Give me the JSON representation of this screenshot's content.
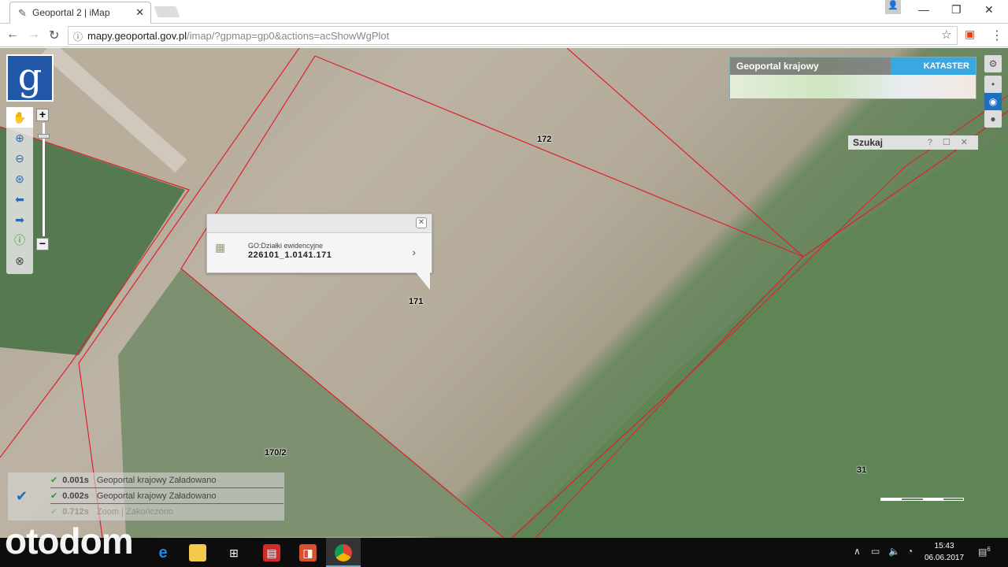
{
  "browser": {
    "tab_title": "Geoportal 2 | iMap",
    "url_host": "mapy.geoportal.gov.pl",
    "url_path": "/imap/?gpmap=gp0&actions=acShowWgPlot"
  },
  "map": {
    "logo": "g",
    "popup": {
      "layer": "GO:Działki ewidencyjne",
      "parcel_id": "226101_1.0141.171"
    },
    "parcel_labels": [
      "172",
      "171",
      "170/2",
      "31"
    ],
    "basemap": {
      "title": "Geoportal krajowy",
      "badge": "KATASTER"
    },
    "search_panel": {
      "title": "Szukaj",
      "controls": "? ☐ ✕"
    },
    "status": [
      {
        "time": "0.001s",
        "source": "Geoportal krajowy",
        "state": "Załadowano"
      },
      {
        "time": "0.002s",
        "source": "Geoportal krajowy",
        "state": "Załadowano"
      },
      {
        "time": "0.712s",
        "source": "Zoom",
        "state": "Zakończono"
      }
    ]
  },
  "taskbar": {
    "time": "15:43",
    "date": "06.06.2017",
    "notifications": "6"
  },
  "watermark": "otodom",
  "colors": {
    "accent": "#2257a8",
    "kataster": "#3aa8e0",
    "parcel_line": "#e0202a"
  }
}
